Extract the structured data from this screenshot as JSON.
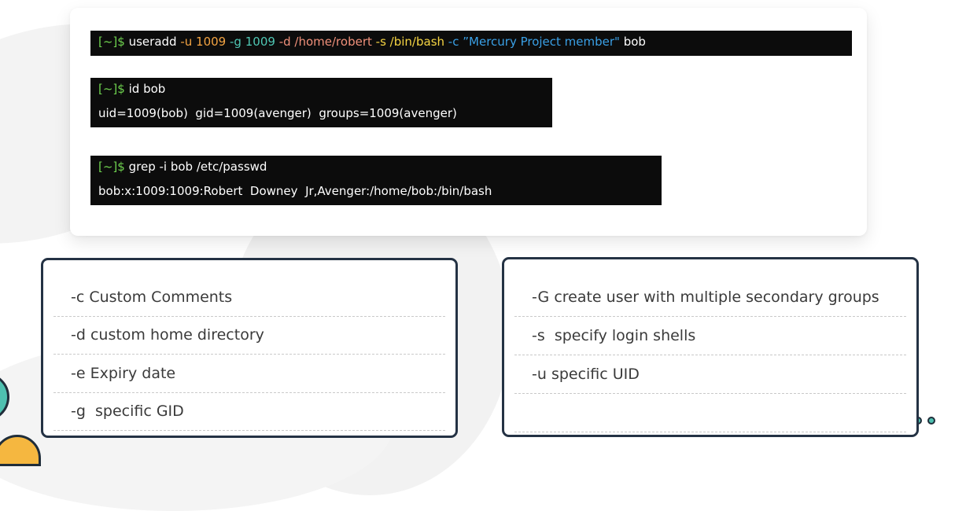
{
  "terminal": {
    "cmd1": {
      "prompt": "[~]$",
      "parts": [
        "useradd",
        "-u",
        "1009",
        "-g",
        "1009",
        "-d",
        "/home/robert",
        "-s",
        "/bin/bash",
        "-c",
        "”Mercury Project member\"",
        "bob"
      ]
    },
    "cmd2": {
      "prompt": "[~]$",
      "command": "id bob",
      "output": "uid=1009(bob)  gid=1009(avenger)  groups=1009(avenger)"
    },
    "cmd3": {
      "prompt": "[~]$",
      "command": "grep -i bob /etc/passwd",
      "output": "bob:x:1009:1009:Robert  Downey  Jr,Avenger:/home/bob:/bin/bash"
    }
  },
  "options_left": [
    "-c Custom Comments",
    "-d custom home directory",
    "-e Expiry date",
    "-g  specific GID"
  ],
  "options_right": [
    "-G create user with multiple secondary groups",
    "-s  specify login shells",
    "-u specific UID",
    ""
  ],
  "colors": {
    "terminal_bg": "#0c0c0c",
    "prompt": "#6fd34f",
    "flag": "#f4a442",
    "number": "#4fc7b4",
    "path": "#f0907a",
    "string_flag": "#3aa0e6",
    "box_border": "#243244"
  }
}
